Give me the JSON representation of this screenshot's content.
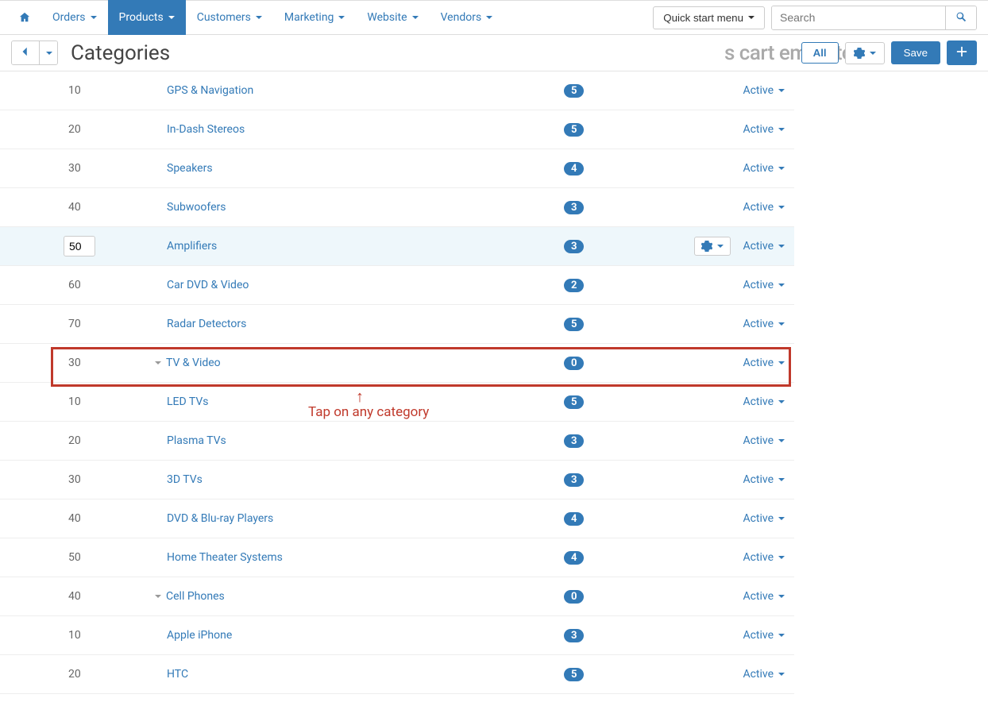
{
  "nav": {
    "orders": "Orders",
    "products": "Products",
    "customers": "Customers",
    "marketing": "Marketing",
    "website": "Website",
    "vendors": "Vendors",
    "quick_start": "Quick start menu",
    "search_placeholder": "Search"
  },
  "page": {
    "title": "Categories",
    "all_btn": "All",
    "save_btn": "Save",
    "bg_text": "s cart emo Sto"
  },
  "annotation": {
    "text": "Tap on any category"
  },
  "rows": [
    {
      "pos": "10",
      "name": "GPS & Navigation",
      "count": "5",
      "status": "Active",
      "level": 1
    },
    {
      "pos": "20",
      "name": "In-Dash Stereos",
      "count": "5",
      "status": "Active",
      "level": 1
    },
    {
      "pos": "30",
      "name": "Speakers",
      "count": "4",
      "status": "Active",
      "level": 1
    },
    {
      "pos": "40",
      "name": "Subwoofers",
      "count": "3",
      "status": "Active",
      "level": 1
    },
    {
      "pos": "50",
      "name": "Amplifiers",
      "count": "3",
      "status": "Active",
      "level": 1,
      "highlighted": true,
      "editable_pos": true,
      "show_gear": true
    },
    {
      "pos": "60",
      "name": "Car DVD & Video",
      "count": "2",
      "status": "Active",
      "level": 1
    },
    {
      "pos": "70",
      "name": "Radar Detectors",
      "count": "5",
      "status": "Active",
      "level": 1
    },
    {
      "pos": "30",
      "name": "TV & Video",
      "count": "0",
      "status": "Active",
      "level": 0,
      "expandable": true,
      "boxed": true
    },
    {
      "pos": "10",
      "name": "LED TVs",
      "count": "5",
      "status": "Active",
      "level": 1
    },
    {
      "pos": "20",
      "name": "Plasma TVs",
      "count": "3",
      "status": "Active",
      "level": 1
    },
    {
      "pos": "30",
      "name": "3D TVs",
      "count": "3",
      "status": "Active",
      "level": 1
    },
    {
      "pos": "40",
      "name": "DVD & Blu-ray Players",
      "count": "4",
      "status": "Active",
      "level": 1
    },
    {
      "pos": "50",
      "name": "Home Theater Systems",
      "count": "4",
      "status": "Active",
      "level": 1
    },
    {
      "pos": "40",
      "name": "Cell Phones",
      "count": "0",
      "status": "Active",
      "level": 0,
      "expandable": true
    },
    {
      "pos": "10",
      "name": "Apple iPhone",
      "count": "3",
      "status": "Active",
      "level": 1
    },
    {
      "pos": "20",
      "name": "HTC",
      "count": "5",
      "status": "Active",
      "level": 1
    }
  ]
}
